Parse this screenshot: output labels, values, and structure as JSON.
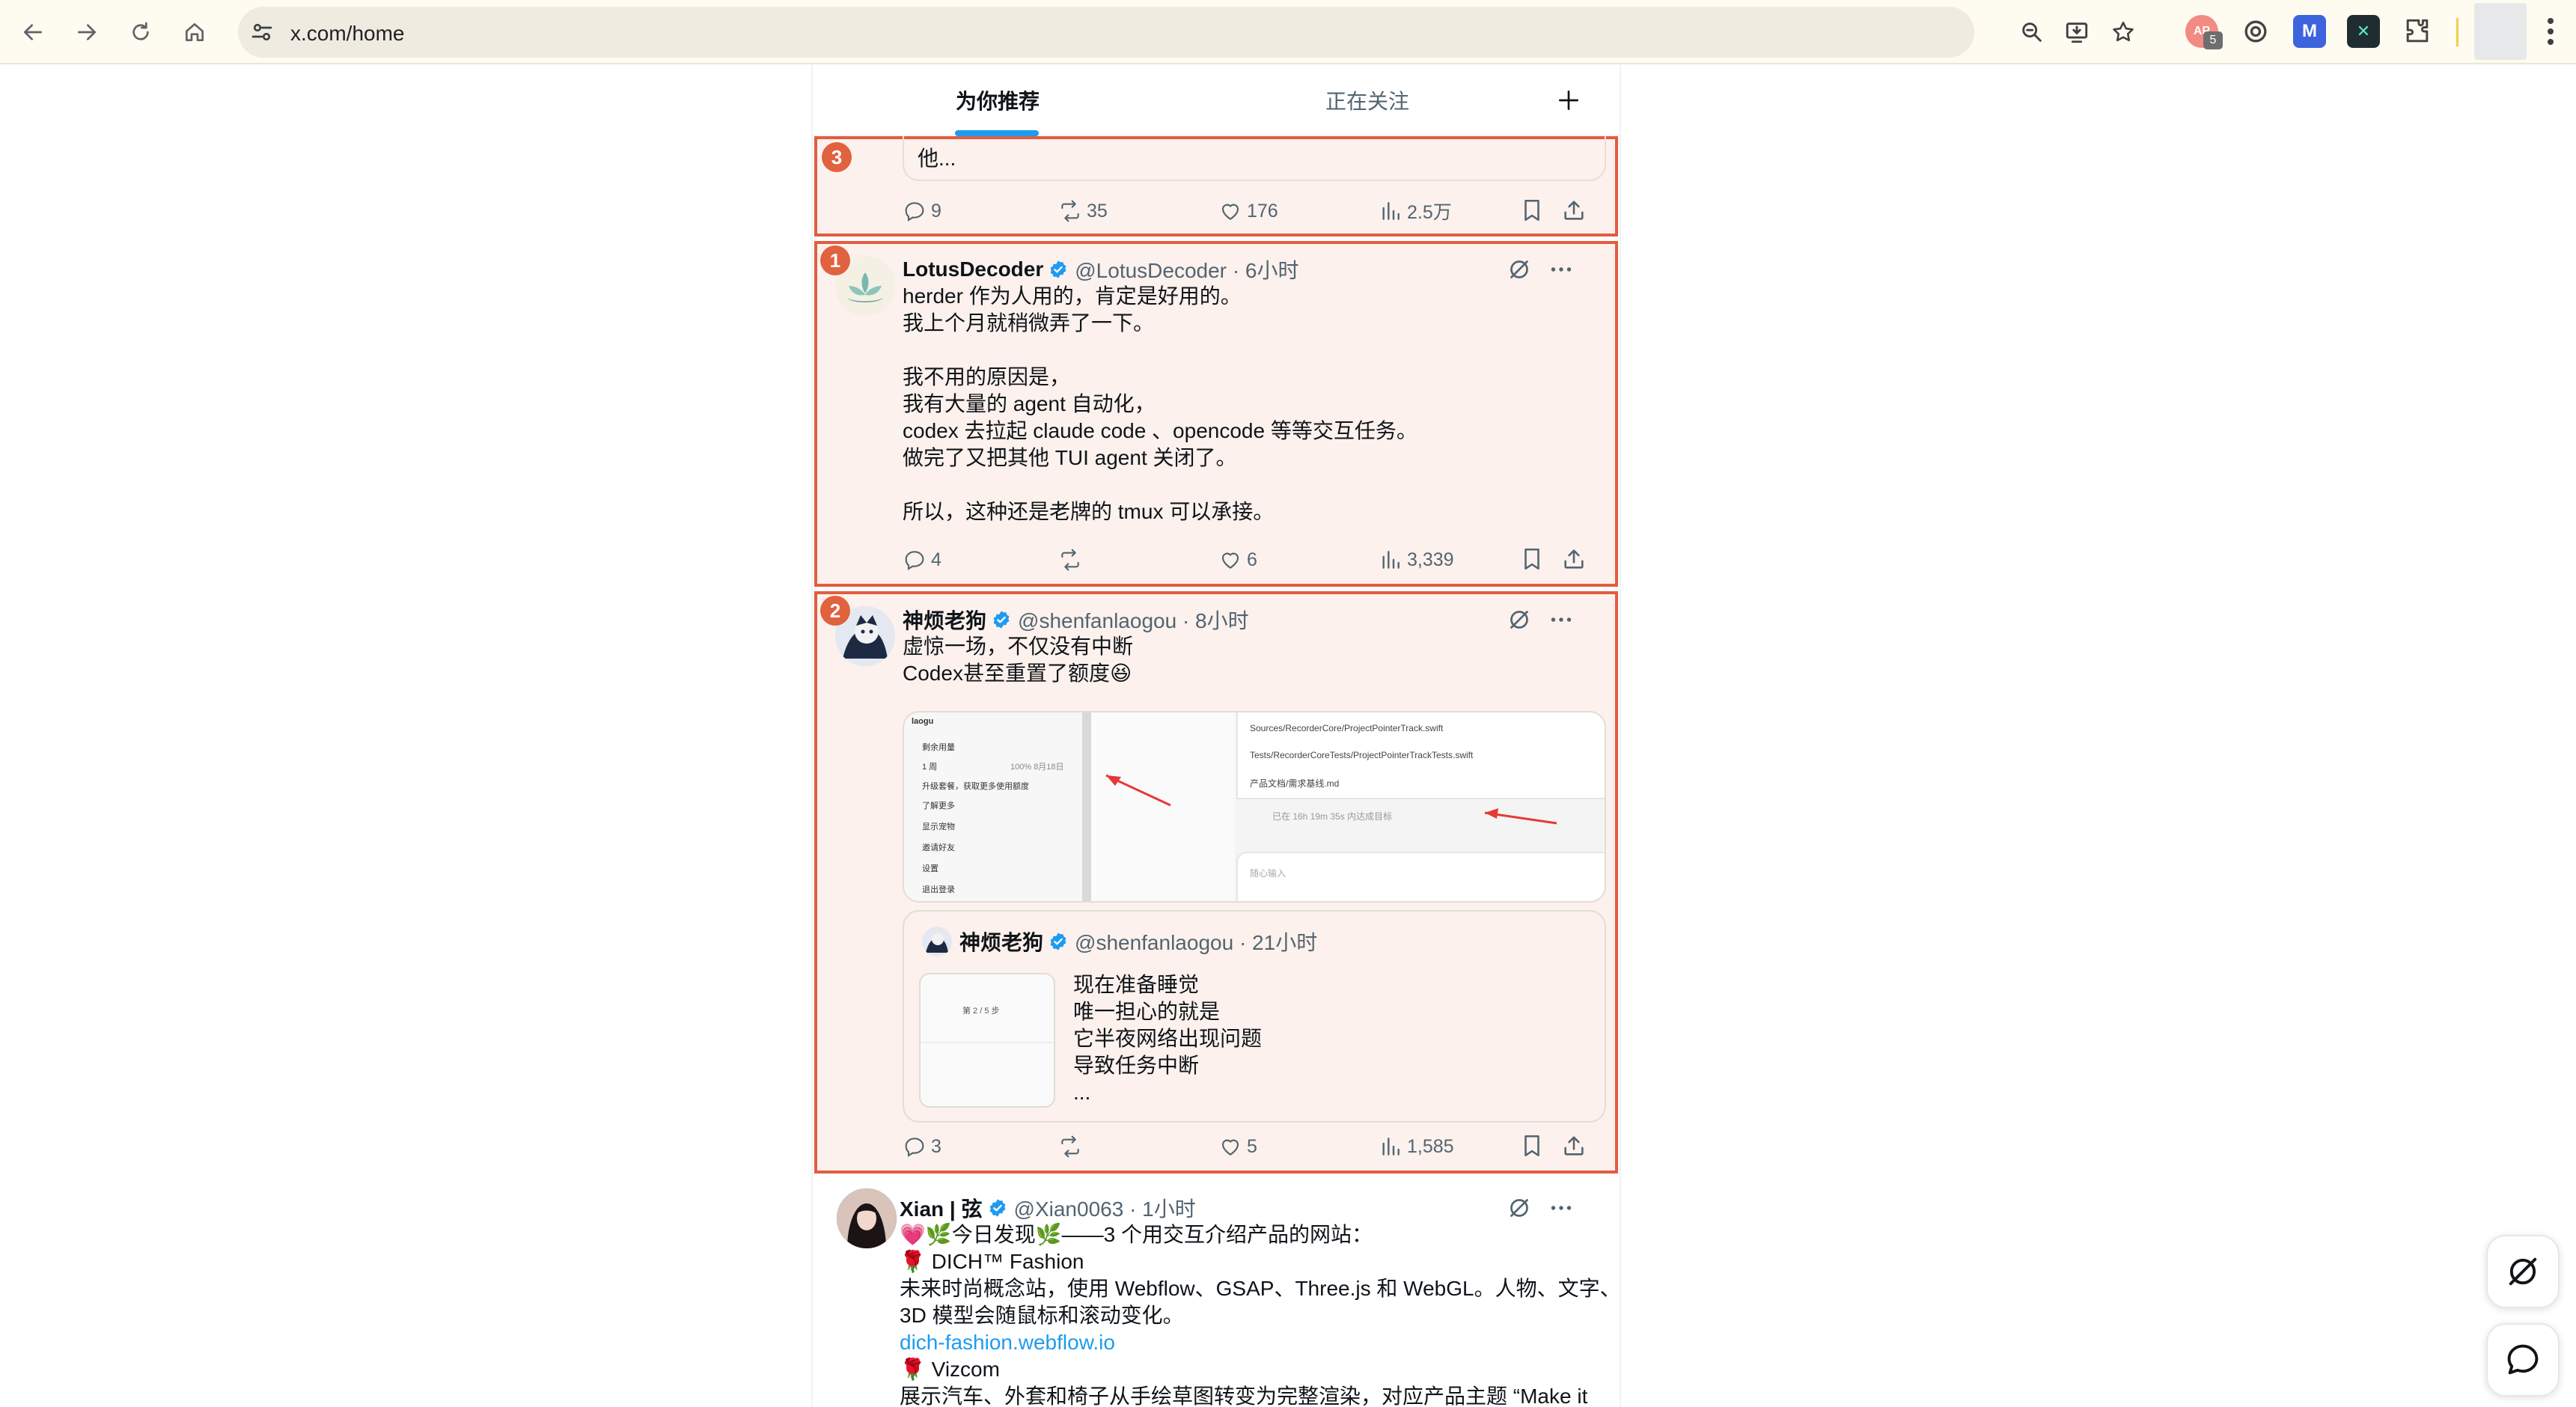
{
  "browser": {
    "url": "x.com/home",
    "extension_badge": "5"
  },
  "tabs": {
    "for_you": "为你推荐",
    "following": "正在关注"
  },
  "post_top": {
    "badge": "3",
    "truncated_text": "他...",
    "reply_count": "9",
    "repost_count": "35",
    "like_count": "176",
    "view_count": "2.5万"
  },
  "post_1": {
    "badge": "1",
    "author_name": "LotusDecoder",
    "handle_time": "@LotusDecoder · 6小时",
    "text": "herder 作为人用的，肯定是好用的。\n我上个月就稍微弄了一下。\n\n我不用的原因是，\n我有大量的 agent 自动化，\ncodex 去拉起 claude code 、opencode 等等交互任务。\n做完了又把其他 TUI agent 关闭了。\n\n所以，这种还是老牌的 tmux 可以承接。",
    "reply_count": "4",
    "like_count": "6",
    "view_count": "3,339"
  },
  "post_2": {
    "badge": "2",
    "author_name": "神烦老狗",
    "handle_time": "@shenfanlaogou · 8小时",
    "text": "虚惊一场，不仅没有中断\nCodex甚至重置了额度😆",
    "media": {
      "menu": {
        "user": "laogu",
        "remaining": "剩余用量",
        "week": "1 周",
        "week_value": "100%  8月18日",
        "upgrade": "升级套餐，获取更多使用额度",
        "learn_more": "了解更多",
        "show_pet": "显示宠物",
        "invite": "邀请好友",
        "settings": "设置",
        "logout": "退出登录"
      },
      "code": {
        "file1": "Sources/RecorderCore/ProjectPointerTrack.swift",
        "file2": "Tests/RecorderCoreTests/ProjectPointerTrackTests.swift",
        "doc": "产品文档/需求基线.md",
        "status": "已在 16h 19m 35s 内达成目标",
        "input_placeholder": "随心输入"
      }
    },
    "quote": {
      "author_name": "神烦老狗",
      "handle_time": "@shenfanlaogou · 21小时",
      "thumb_text": "第 2 / 5 步",
      "text": "现在准备睡觉\n唯一担心的就是\n它半夜网络出现问题\n导致任务中断\n..."
    },
    "reply_count": "3",
    "like_count": "5",
    "view_count": "1,585"
  },
  "post_3": {
    "author_name": "Xian | 弦",
    "handle_time": "@Xian0063 · 1小时",
    "line1": "💗🌿今日发现🌿——3 个用交互介绍产品的网站：",
    "line2": "🌹 DICH™ Fashion",
    "line3": "未来时尚概念站，使用 Webflow、GSAP、Three.js 和 WebGL。人物、文字、",
    "line4": "3D 模型会随鼠标和滚动变化。",
    "link": "dich-fashion.webflow.io",
    "line5": "🌹 Vizcom",
    "line6": "展示汽车、外套和椅子从手绘草图转变为完整渲染，对应产品主题 “Make it"
  },
  "colors": {
    "accent": "#1d9bf0",
    "highlight_border": "#e35c40",
    "highlight_fill": "#fcf1ec",
    "verified": "#1d9bf0"
  }
}
